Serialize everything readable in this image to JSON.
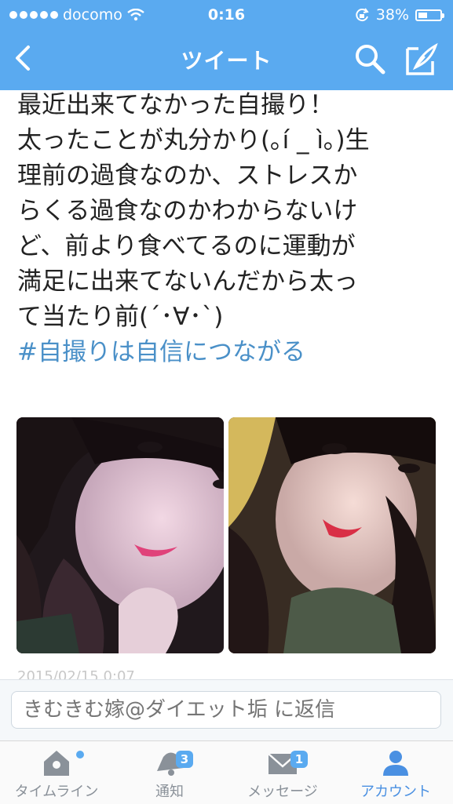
{
  "status_bar": {
    "carrier": "docomo",
    "time": "0:16",
    "battery": "38%"
  },
  "nav": {
    "title": "ツイート"
  },
  "tweet": {
    "lines": [
      "最近出来てなかった自撮り！",
      "太ったことが丸分かり(｡í _ ì｡)生",
      "理前の過食なのか、ストレスか",
      "らくる過食なのかわからないけ",
      "ど、前より食べてるのに運動が",
      "満足に出来てないんだから太っ",
      "て当たり前(´･∀･`)"
    ],
    "hashtag": "#自撮りは自信につながる",
    "timestamp": "2015/02/15 0:07"
  },
  "reply": {
    "placeholder": "きむきむ嫁@ダイエット垢 に返信"
  },
  "tabs": [
    {
      "label": "タイムライン",
      "icon": "home-icon"
    },
    {
      "label": "通知",
      "icon": "bell-icon",
      "badge": "3"
    },
    {
      "label": "メッセージ",
      "icon": "envelope-icon",
      "badge": "1"
    },
    {
      "label": "アカウント",
      "icon": "person-icon"
    }
  ],
  "colors": {
    "header": "#5aaaf0",
    "hashtag": "#4a90c8",
    "active_tab": "#4a90e2"
  }
}
